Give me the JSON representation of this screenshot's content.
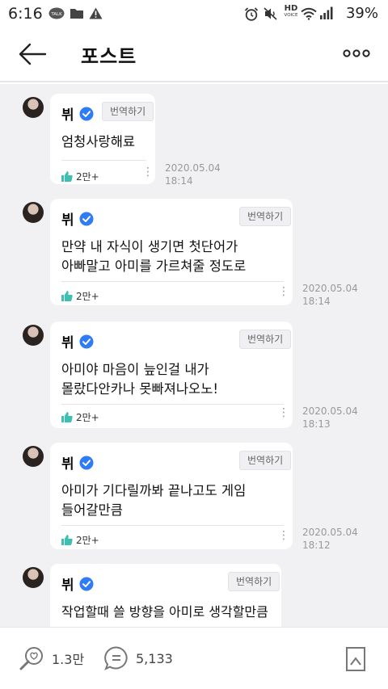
{
  "status": {
    "time": "6:16",
    "talk_badge": "TALK",
    "battery": "39%",
    "hd_label": "HD",
    "voice_label": "VOICE"
  },
  "header": {
    "title": "포스트"
  },
  "posts": [
    {
      "author": "뷔",
      "translate": "번역하기",
      "text": "엄청사랑해료",
      "likes": "2만+",
      "timestamp": "2020.05.04\n18:14"
    },
    {
      "author": "뷔",
      "translate": "번역하기",
      "text": "만약 내 자식이 생기면 첫단어가\n아빠말고 아미를 가르쳐줄 정도로",
      "likes": "2만+",
      "timestamp": "2020.05.04\n18:14"
    },
    {
      "author": "뷔",
      "translate": "번역하기",
      "text": "아미야 마음이 늪인걸 내가\n몰랐다안카나 못빠져나오노!",
      "likes": "2만+",
      "timestamp": "2020.05.04\n18:13"
    },
    {
      "author": "뷔",
      "translate": "번역하기",
      "text": "아미가 기다릴까봐 끝나고도 게임\n들어갈만큼",
      "likes": "2만+",
      "timestamp": "2020.05.04\n18:12"
    },
    {
      "author": "뷔",
      "translate": "번역하기",
      "text": "작업할때 쓸 방향을 아미로 생각할만큼",
      "likes": "",
      "timestamp": ""
    }
  ],
  "bottom": {
    "likes": "1.3만",
    "comments": "5,133"
  },
  "colors": {
    "verified": "#2f7cf6",
    "like": "#3dbfb1",
    "feed_bg": "#f1f1f4"
  }
}
